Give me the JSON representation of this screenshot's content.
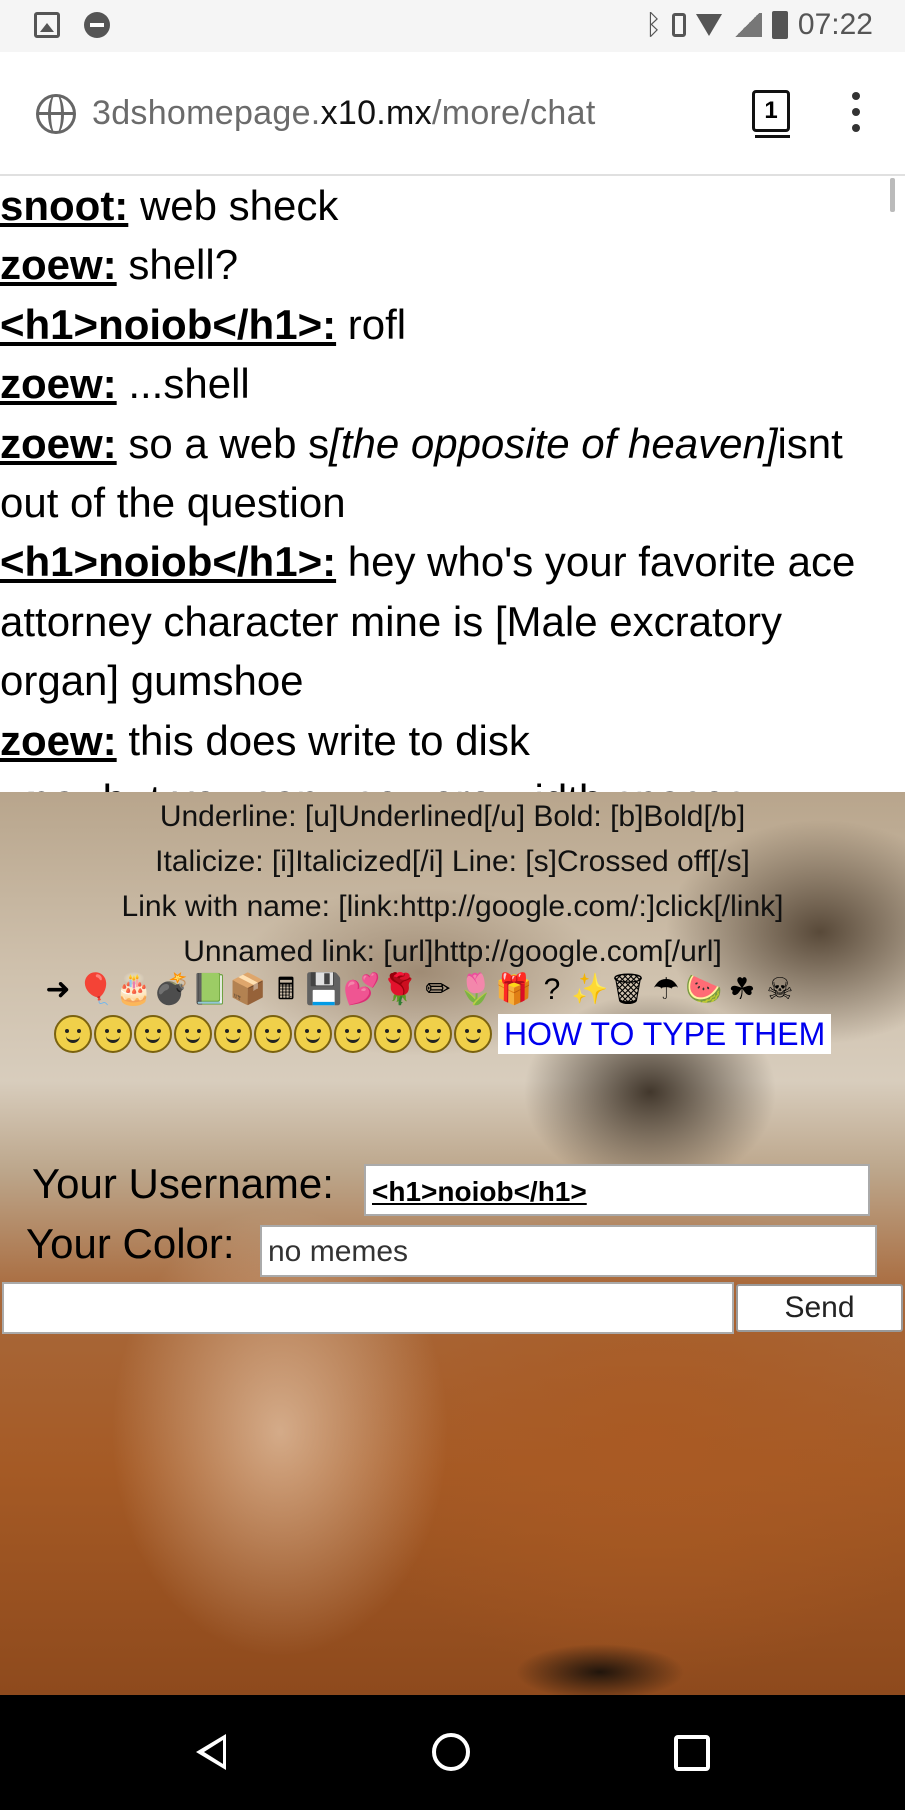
{
  "status_bar": {
    "time": "07:22"
  },
  "browser": {
    "url_host": "3dshomepage.",
    "url_domain": "x10.mx",
    "url_path": "/more/chat",
    "tab_count": "1"
  },
  "chat": {
    "messages": [
      {
        "user": "snoot:",
        "text": " web sheck"
      },
      {
        "user": "zoew:",
        "text": " shell?"
      },
      {
        "user": "<h1>noiob</h1>:",
        "text": " rofl"
      },
      {
        "user": "zoew:",
        "text": " ...shell"
      },
      {
        "user": "zoew:",
        "text": " so a web s",
        "italic": "[the opposite of heaven]",
        "text2": "isnt out of the question"
      },
      {
        "user": "<h1>noiob</h1>:",
        "text": " hey who's your favorite ace attorney character mine is [Male excratory organ] gumshoe"
      },
      {
        "user": "zoew:",
        "text": " this does write to disk"
      },
      {
        "user": "uno:",
        "text": " but you can use zero width spaces"
      }
    ]
  },
  "formatting_help": {
    "line1": "Underline: [u]Underlined[/u] Bold: [b]Bold[/b]",
    "line2": "Italicize: [i]Italicized[/i] Line: [s]Crossed off[/s]",
    "line3": "Link with name: [link:http://google.com/:]click[/link]",
    "line4": "Unnamed link: [url]http://google.com[/url]"
  },
  "emoticons": {
    "row1_icons": [
      "arrow-icon",
      "balloons-icon",
      "cake-icon",
      "bomb-icon",
      "book-icon",
      "box-icon",
      "calculator-icon",
      "floppy-icon",
      "hearts-icon",
      "rose-icon",
      "pencil-icon",
      "tulip-icon",
      "gift-icon",
      "question-block-icon",
      "sparkle-icon",
      "trash-icon",
      "umbrella-icon",
      "watermelon-icon",
      "holly-icon",
      "skull-icon"
    ],
    "row1_glyphs": [
      "➜",
      "🎈",
      "🎂",
      "💣",
      "📗",
      "📦",
      "🖩",
      "💾",
      "💕",
      "🌹",
      "✏",
      "🌷",
      "🎁",
      "?",
      "✨",
      "🗑",
      "☂",
      "🍉",
      "☘",
      "☠"
    ],
    "smiley_count": 11,
    "how_link": "HOW TO TYPE THEM"
  },
  "form": {
    "username_label": "Your Username:",
    "username_value": "<h1>noiob</h1>",
    "color_label": "Your Color:",
    "color_value": "no memes",
    "message_value": "",
    "send_label": "Send"
  }
}
